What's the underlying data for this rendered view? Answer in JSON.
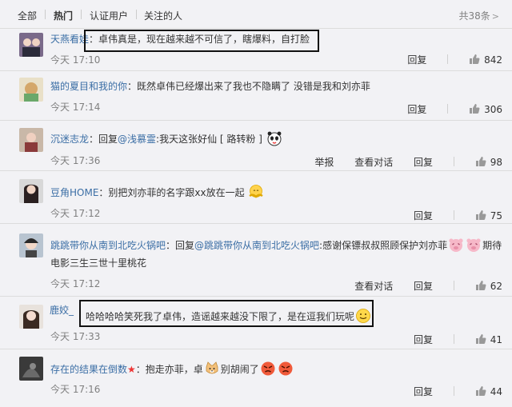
{
  "tabs": {
    "all": "全部",
    "hot": "热门",
    "verified": "认证用户",
    "following": "关注的人"
  },
  "total": "共38条",
  "actions": {
    "reply": "回复",
    "report": "举报",
    "view_convo": "查看对话"
  },
  "comments": [
    {
      "user": "天燕看娃",
      "text": "：卓伟真是，现在越来越不可信了，瞎爆料，自打脸",
      "time": "今天 17:10",
      "likes": "842"
    },
    {
      "user": "猫的夏目和我的你",
      "text": "：既然卓伟已经爆出来了我也不隐瞒了 没错是我和刘亦菲",
      "time": "今天 17:14",
      "likes": "306"
    },
    {
      "user": "沉迷志龙",
      "pre": "：回复",
      "mention": "@浅慕霊",
      "text": ":我天这张好仙 [ 路转粉 ]",
      "time": "今天 17:36",
      "likes": "98"
    },
    {
      "user": "豆角HOME",
      "text": "：别把刘亦菲的名字跟xx放在一起",
      "time": "今天 17:12",
      "likes": "75"
    },
    {
      "user": "跳跳带你从南到北吃火锅吧",
      "pre": "：回复",
      "mention": "@跳跳带你从南到北吃火锅吧",
      "text": ":感谢保镖叔叔照顾保护刘亦菲",
      "text_after": "期待",
      "line2": "电影三生三世十里桃花",
      "time": "今天 17:12",
      "likes": "62"
    },
    {
      "user": "鹿姣_",
      "text": "哈哈哈哈笑死我了卓伟，造谣越来越没下限了，是在逗我们玩呢",
      "time": "今天 17:33",
      "likes": "41"
    },
    {
      "user": "存在的结果在倒数",
      "star": "★",
      "text": "：抱走亦菲，卓",
      "text_after": "别胡闹了",
      "time": "今天 17:16",
      "likes": "44"
    }
  ],
  "colors": {
    "link": "#3b6ea5",
    "background": "#f2f2f5",
    "highlight_box": "#111111"
  }
}
